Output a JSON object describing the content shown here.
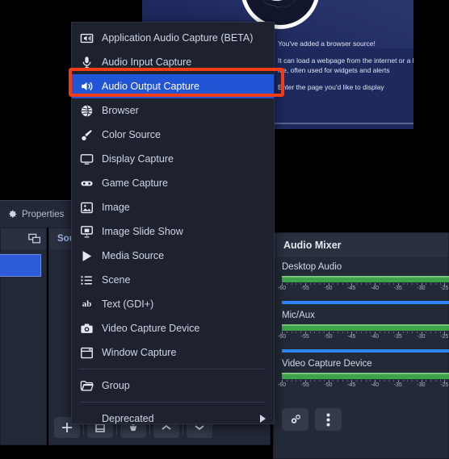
{
  "preview": {
    "lines": [
      "You've added a browser source!",
      "",
      "It can load a webpage from the internet or a local",
      "file, often used for widgets and alerts",
      "",
      "Enter the page you'd like to display"
    ]
  },
  "properties_window": {
    "title": "Properties",
    "icon": "gear-icon"
  },
  "scenes": {
    "header_icon": "windows-icon"
  },
  "sources": {
    "header_label": "Sources",
    "toolbar": [
      {
        "name": "add-source-button",
        "glyph": "+"
      },
      {
        "name": "remove-source-button",
        "glyph": "⊟"
      },
      {
        "name": "source-properties-button",
        "glyph": "⚙"
      },
      {
        "name": "move-source-up-button",
        "glyph": "∧"
      },
      {
        "name": "move-source-down-button",
        "glyph": "∨"
      }
    ]
  },
  "audio_mixer": {
    "title": "Audio Mixer",
    "db_ticks": [
      -60,
      -55,
      -50,
      -45,
      -40,
      -35,
      -30,
      -25
    ],
    "channels": [
      {
        "name": "Desktop Audio",
        "meter_percent": 100,
        "volume_percent": 100
      },
      {
        "name": "Mic/Aux",
        "meter_percent": 100,
        "volume_percent": 100
      },
      {
        "name": "Video Capture Device",
        "meter_percent": 100,
        "volume_percent": 100
      }
    ],
    "tools": [
      {
        "name": "audio-mixer-settings-button",
        "icon": "gears-icon"
      },
      {
        "name": "audio-mixer-menu-button",
        "icon": "kebab-menu-icon"
      }
    ]
  },
  "context_menu": {
    "items": [
      {
        "label": "Application Audio Capture (BETA)",
        "icon": "app-audio-icon",
        "selected": false,
        "submenu": false
      },
      {
        "label": "Audio Input Capture",
        "icon": "microphone-icon",
        "selected": false,
        "submenu": false
      },
      {
        "label": "Audio Output Capture",
        "icon": "speaker-icon",
        "selected": true,
        "submenu": false
      },
      {
        "label": "Browser",
        "icon": "globe-icon",
        "selected": false,
        "submenu": false
      },
      {
        "label": "Color Source",
        "icon": "brush-icon",
        "selected": false,
        "submenu": false
      },
      {
        "label": "Display Capture",
        "icon": "monitor-icon",
        "selected": false,
        "submenu": false
      },
      {
        "label": "Game Capture",
        "icon": "gamepad-icon",
        "selected": false,
        "submenu": false
      },
      {
        "label": "Image",
        "icon": "image-icon",
        "selected": false,
        "submenu": false
      },
      {
        "label": "Image Slide Show",
        "icon": "slideshow-icon",
        "selected": false,
        "submenu": false
      },
      {
        "label": "Media Source",
        "icon": "play-icon",
        "selected": false,
        "submenu": false
      },
      {
        "label": "Scene",
        "icon": "list-icon",
        "selected": false,
        "submenu": false
      },
      {
        "label": "Text (GDI+)",
        "icon": "text-ab-icon",
        "selected": false,
        "submenu": false
      },
      {
        "label": "Video Capture Device",
        "icon": "camera-icon",
        "selected": false,
        "submenu": false
      },
      {
        "label": "Window Capture",
        "icon": "window-icon",
        "selected": false,
        "submenu": false
      },
      {
        "label": "Group",
        "icon": "folder-icon",
        "selected": false,
        "submenu": false
      },
      {
        "label": "Deprecated",
        "icon": "none",
        "selected": false,
        "submenu": true
      }
    ],
    "separator_after": [
      13,
      14
    ],
    "highlight_color": "#f23c16",
    "selected_color": "#2255d6"
  }
}
